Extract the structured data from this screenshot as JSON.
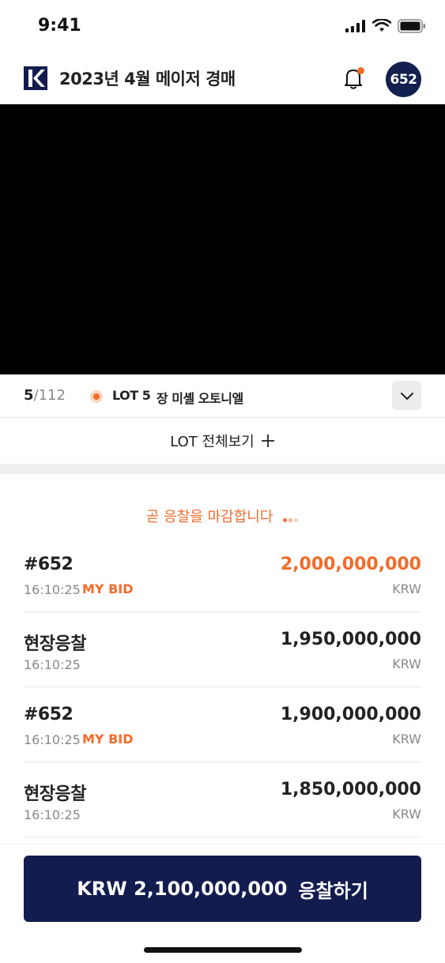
{
  "status_bar": {
    "time": "9:41"
  },
  "header": {
    "title": "2023년 4월 메이저 경매",
    "paddle_number": "652"
  },
  "lot_bar": {
    "current": "5",
    "total": "/112",
    "lot_label": "LOT 5",
    "artist": "장 미셸 오토니엘"
  },
  "view_all_label": "LOT 전체보기",
  "closing_notice": "곧 응찰을 마감합니다",
  "bids": [
    {
      "bidder": "#652",
      "time": "16:10:25",
      "tag": "MY BID",
      "amount": "2,000,000,000",
      "currency": "KRW"
    },
    {
      "bidder": "현장응찰",
      "time": "16:10:25",
      "tag": "",
      "amount": "1,950,000,000",
      "currency": "KRW"
    },
    {
      "bidder": "#652",
      "time": "16:10:25",
      "tag": "MY BID",
      "amount": "1,900,000,000",
      "currency": "KRW"
    },
    {
      "bidder": "현장응찰",
      "time": "16:10:25",
      "tag": "",
      "amount": "1,850,000,000",
      "currency": "KRW"
    }
  ],
  "bid_button": {
    "amount_label": "KRW 2,100,000,000",
    "action_label": "응찰하기"
  },
  "colors": {
    "accent": "#f26b2a",
    "navy": "#131c4f"
  }
}
